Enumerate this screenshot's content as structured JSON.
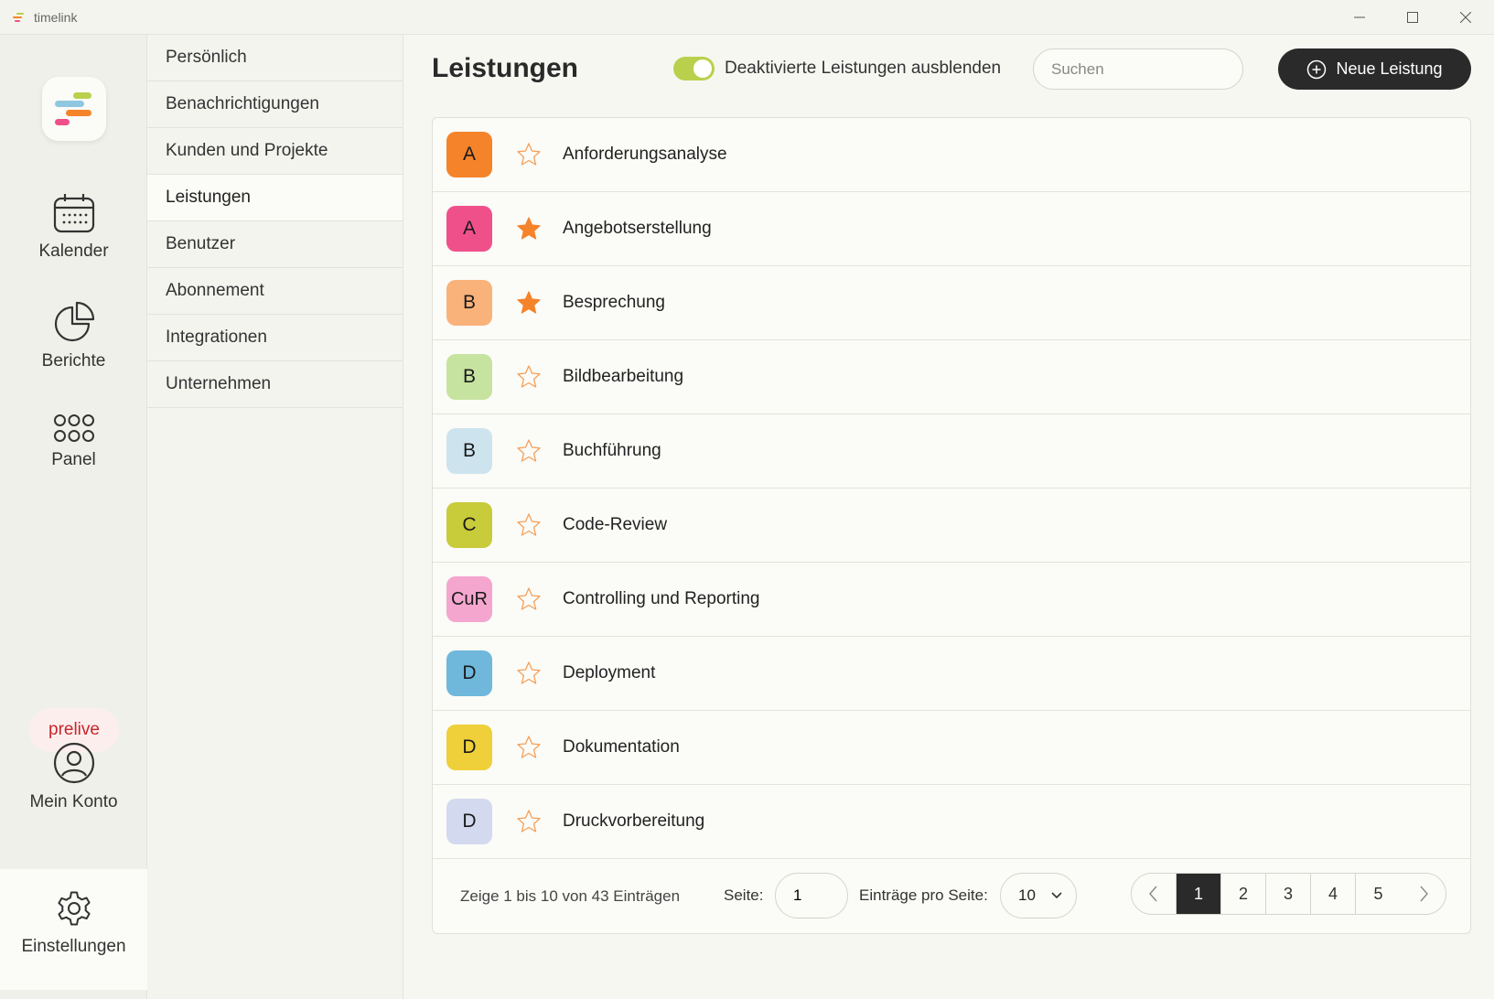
{
  "window": {
    "title": "timelink"
  },
  "rail": {
    "items": [
      {
        "label": "Kalender",
        "icon": "calendar-icon"
      },
      {
        "label": "Berichte",
        "icon": "pie-chart-icon"
      },
      {
        "label": "Panel",
        "icon": "grid-dots-icon"
      }
    ],
    "env_badge": "prelive",
    "account": {
      "label": "Mein Konto",
      "icon": "user-circle-icon"
    },
    "settings": {
      "label": "Einstellungen",
      "icon": "gear-icon"
    }
  },
  "subnav": {
    "items": [
      {
        "label": "Persönlich",
        "active": false
      },
      {
        "label": "Benachrichtigungen",
        "active": false
      },
      {
        "label": "Kunden und Projekte",
        "active": false
      },
      {
        "label": "Leistungen",
        "active": true
      },
      {
        "label": "Benutzer",
        "active": false
      },
      {
        "label": "Abonnement",
        "active": false
      },
      {
        "label": "Integrationen",
        "active": false
      },
      {
        "label": "Unternehmen",
        "active": false
      }
    ]
  },
  "header": {
    "title": "Leistungen",
    "toggle_label": "Deaktivierte Leistungen ausblenden",
    "toggle_on": true,
    "search_placeholder": "Suchen",
    "new_button_label": "Neue Leistung"
  },
  "services": [
    {
      "initials": "A",
      "name": "Anforderungsanalyse",
      "favorite": false,
      "color": "#f5832a"
    },
    {
      "initials": "A",
      "name": "Angebotserstellung",
      "favorite": true,
      "color": "#f0508a"
    },
    {
      "initials": "B",
      "name": "Besprechung",
      "favorite": true,
      "color": "#f9b27a"
    },
    {
      "initials": "B",
      "name": "Bildbearbeitung",
      "favorite": false,
      "color": "#c7e3a0"
    },
    {
      "initials": "B",
      "name": "Buchführung",
      "favorite": false,
      "color": "#cde4ef"
    },
    {
      "initials": "C",
      "name": "Code-Review",
      "favorite": false,
      "color": "#c8cb3a"
    },
    {
      "initials": "CuR",
      "name": "Controlling und Reporting",
      "favorite": false,
      "color": "#f4a6cf"
    },
    {
      "initials": "D",
      "name": "Deployment",
      "favorite": false,
      "color": "#6fb8dc"
    },
    {
      "initials": "D",
      "name": "Dokumentation",
      "favorite": false,
      "color": "#efd03a"
    },
    {
      "initials": "D",
      "name": "Druckvorbereitung",
      "favorite": false,
      "color": "#d3d9ee"
    }
  ],
  "footer": {
    "entries_info": "Zeige 1 bis 10 von 43 Einträgen",
    "page_label": "Seite:",
    "page_value": "1",
    "per_page_label": "Einträge pro Seite:",
    "per_page_value": "10",
    "pages": [
      "1",
      "2",
      "3",
      "4",
      "5"
    ],
    "current_page": "1"
  },
  "colors": {
    "accent_dark": "#2a2a2a",
    "toggle_on": "#b9d04c",
    "star": "#f5832a",
    "prelive_text": "#c8262a"
  }
}
